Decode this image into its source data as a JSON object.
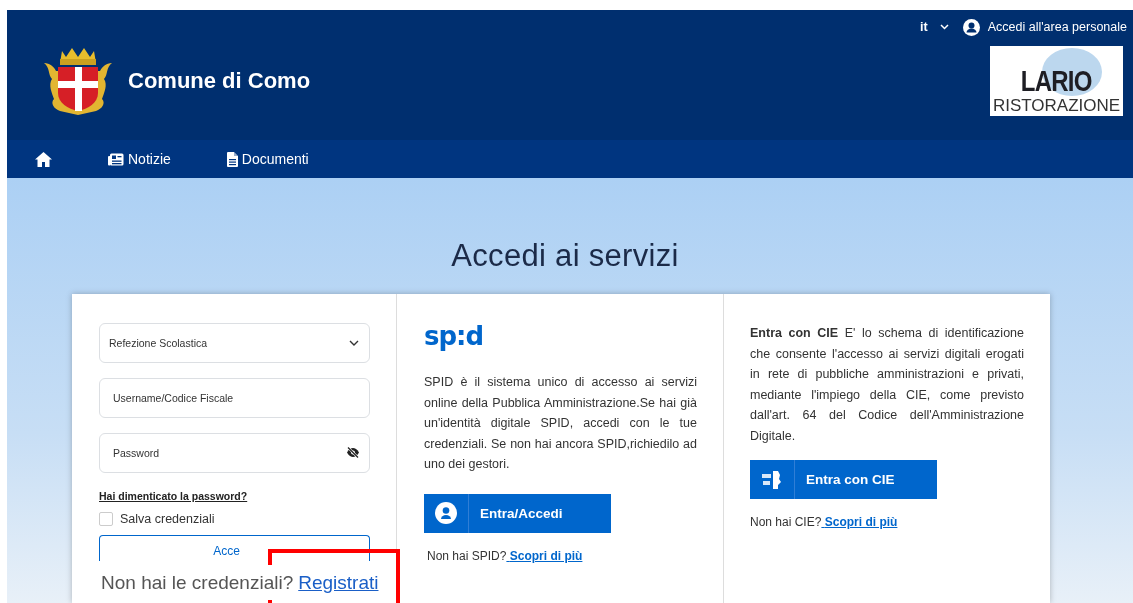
{
  "header": {
    "language": "it",
    "account_link": "Accedi all'area personale",
    "site_title": "Comune di Como",
    "partner_logo": {
      "line_1": "LARIO",
      "line_2": "RISTORAZIONE"
    }
  },
  "nav": {
    "items": [
      {
        "label": "Notizie",
        "kind": "news"
      },
      {
        "label": "Documenti",
        "kind": "document"
      }
    ]
  },
  "page_title": "Accedi ai servizi",
  "login_form": {
    "service_select": "Refezione Scolastica",
    "username": {
      "placeholder": "Username/Codice Fiscale"
    },
    "password": {
      "placeholder": "Password"
    },
    "forgot_link": "Hai dimenticato la password?",
    "remember": {
      "label": "Salva credenziali",
      "checked": false
    },
    "submit": "Acce"
  },
  "spid": {
    "logo": "sp:d",
    "description": "SPID è il sistema unico di accesso ai servizi online della Pubblica Amministrazione.Se hai già un'identità digitale SPID, accedi con le tue credenziali. Se non hai ancora SPID,richiedilo ad uno dei gestori.",
    "button": "Entra/Accedi",
    "footer": "Non hai SPID?",
    "footer_link": "Scopri di più"
  },
  "cie": {
    "description": "**Entra con CIE** E' lo schema di identificazione che consente l'accesso ai servizi digitali erogati in rete di pubbliche amministrazioni e privati, mediante l'impiego della CIE, come previsto dall'art. 64 del Codice dell'Amministrazione Digitale.",
    "button": "Entra con CIE",
    "footer": "Non hai CIE?",
    "footer_link": "Scopri di più"
  },
  "register_banner": {
    "text": "Non hai le credenziali?",
    "link": "Registrati"
  }
}
